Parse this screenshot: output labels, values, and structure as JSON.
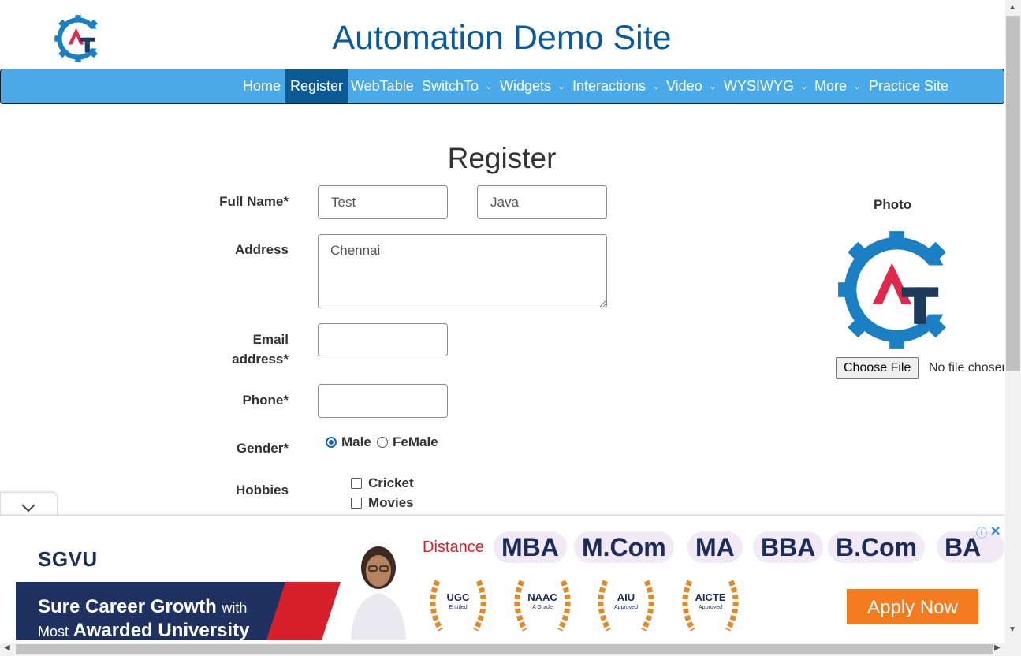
{
  "site_title": "Automation Demo Site",
  "nav": {
    "items": [
      {
        "label": "Home",
        "active": false,
        "dropdown": false
      },
      {
        "label": "Register",
        "active": true,
        "dropdown": false
      },
      {
        "label": "WebTable",
        "active": false,
        "dropdown": false
      },
      {
        "label": "SwitchTo",
        "active": false,
        "dropdown": true
      },
      {
        "label": "Widgets",
        "active": false,
        "dropdown": true
      },
      {
        "label": "Interactions",
        "active": false,
        "dropdown": true
      },
      {
        "label": "Video",
        "active": false,
        "dropdown": true
      },
      {
        "label": "WYSIWYG",
        "active": false,
        "dropdown": true
      },
      {
        "label": "More",
        "active": false,
        "dropdown": true
      },
      {
        "label": "Practice Site",
        "active": false,
        "dropdown": false
      }
    ],
    "chevron_glyph": "⌄"
  },
  "page_heading": "Register",
  "form": {
    "full_name_label": "Full Name*",
    "first_name_value": "Test",
    "last_name_value": "Java",
    "address_label": "Address",
    "address_value": "Chennai",
    "email_label_line1": "Email",
    "email_label_line2": "address*",
    "email_value": "",
    "phone_label": "Phone*",
    "phone_value": "",
    "gender_label": "Gender*",
    "gender_options": [
      {
        "label": "Male",
        "checked": true
      },
      {
        "label": "FeMale",
        "checked": false
      }
    ],
    "hobbies_label": "Hobbies",
    "hobbies": [
      {
        "label": "Cricket",
        "checked": false
      },
      {
        "label": "Movies",
        "checked": false
      }
    ]
  },
  "photo": {
    "label": "Photo",
    "choose_file_label": "Choose File",
    "file_status": "No file chosen"
  },
  "ad": {
    "brand": "SGVU",
    "line1_bold": "Sure Career Growth",
    "line1_small": "with",
    "line2_small": "Most",
    "line2_bold": "Awarded University",
    "distance_label": "Distance",
    "programs": [
      "MBA",
      "M.Com",
      "MA",
      "BBA",
      "B.Com",
      "BA"
    ],
    "badges": [
      {
        "title": "UGC",
        "sub": "Entitled"
      },
      {
        "title": "NAAC",
        "sub": "A Grade"
      },
      {
        "title": "AIU",
        "sub": "Approved"
      },
      {
        "title": "AICTE",
        "sub": "Approved"
      }
    ],
    "apply_label": "Apply Now",
    "info_glyph": "ⓘ",
    "close_glyph": "✕"
  },
  "colors": {
    "nav_bg": "#4aa9e9",
    "nav_active_bg": "#0b5a95",
    "title_color": "#0a5a9e",
    "logo_gear": "#1b7fc4",
    "logo_red": "#e0284a",
    "logo_dark": "#1d3b5c",
    "apply_bg": "#f47b20"
  },
  "icons": {
    "logo": "gear-at-logo-icon",
    "collapse": "chevron-down-icon"
  }
}
